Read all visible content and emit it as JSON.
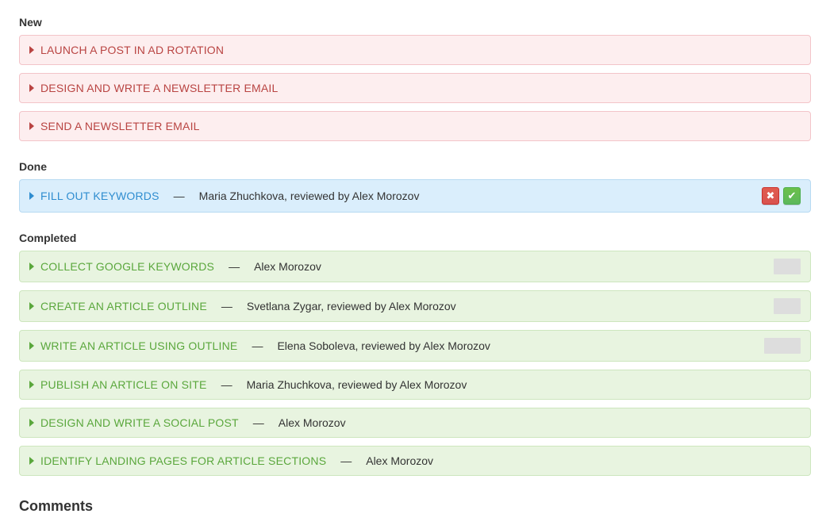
{
  "sections": {
    "new": {
      "header": "New",
      "items": [
        {
          "title": "LAUNCH A POST IN AD ROTATION",
          "assignee": null
        },
        {
          "title": "DESIGN AND WRITE A NEWSLETTER EMAIL",
          "assignee": null
        },
        {
          "title": "SEND A NEWSLETTER EMAIL",
          "assignee": null
        }
      ]
    },
    "done": {
      "header": "Done",
      "items": [
        {
          "title": "FILL OUT KEYWORDS",
          "assignee": "Maria Zhuchkova, reviewed by Alex Morozov",
          "has_approve_reject": true
        }
      ]
    },
    "completed": {
      "header": "Completed",
      "items": [
        {
          "title": "COLLECT GOOGLE KEYWORDS",
          "assignee": "Alex Morozov",
          "has_thumb": true
        },
        {
          "title": "CREATE AN ARTICLE OUTLINE",
          "assignee": "Svetlana Zygar, reviewed by Alex Morozov",
          "has_thumb": true
        },
        {
          "title": "WRITE AN ARTICLE USING OUTLINE",
          "assignee": "Elena Soboleva, reviewed by Alex Morozov",
          "has_thumb": true
        },
        {
          "title": "PUBLISH AN ARTICLE ON SITE",
          "assignee": "Maria Zhuchkova, reviewed by Alex Morozov",
          "has_thumb": false
        },
        {
          "title": "DESIGN AND WRITE A SOCIAL POST",
          "assignee": "Alex Morozov",
          "has_thumb": false
        },
        {
          "title": "IDENTIFY LANDING PAGES FOR ARTICLE SECTIONS",
          "assignee": "Alex Morozov",
          "has_thumb": false
        }
      ]
    }
  },
  "comments_header": "Comments",
  "glyphs": {
    "dash": "—",
    "check": "✔",
    "cross": "✖"
  }
}
